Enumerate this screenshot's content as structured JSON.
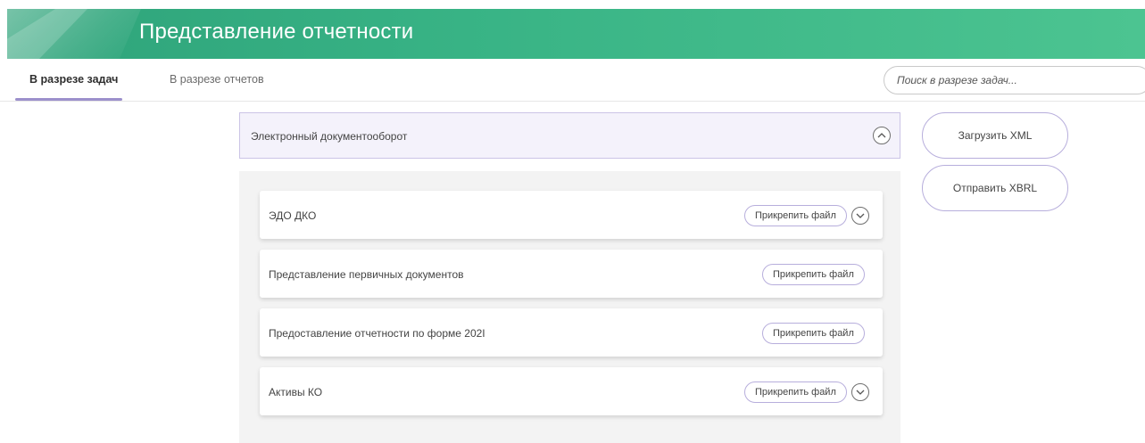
{
  "header": {
    "title": "Представление отчетности"
  },
  "tabs": [
    {
      "label": "В разрезе задач",
      "active": true
    },
    {
      "label": "В разрезе отчетов",
      "active": false
    }
  ],
  "search": {
    "placeholder": "Поиск в разрезе задач..."
  },
  "section": {
    "title": "Электронный документооборот",
    "expanded": true
  },
  "tasks": [
    {
      "label": "ЭДО ДКО",
      "button": "Прикрепить файл",
      "expandable": true
    },
    {
      "label": "Представление первичных документов",
      "button": "Прикрепить файл",
      "expandable": false
    },
    {
      "label": "Предоставление отчетности по форме 202I",
      "button": "Прикрепить файл",
      "expandable": false
    },
    {
      "label": "Активы КО",
      "button": "Прикрепить файл",
      "expandable": true
    }
  ],
  "actions": {
    "upload_xml": "Загрузить XML",
    "send_xbrl": "Отправить XBRL"
  },
  "colors": {
    "header_start": "#2ea37a",
    "header_end": "#4cc491",
    "accent": "#9c90cc"
  }
}
